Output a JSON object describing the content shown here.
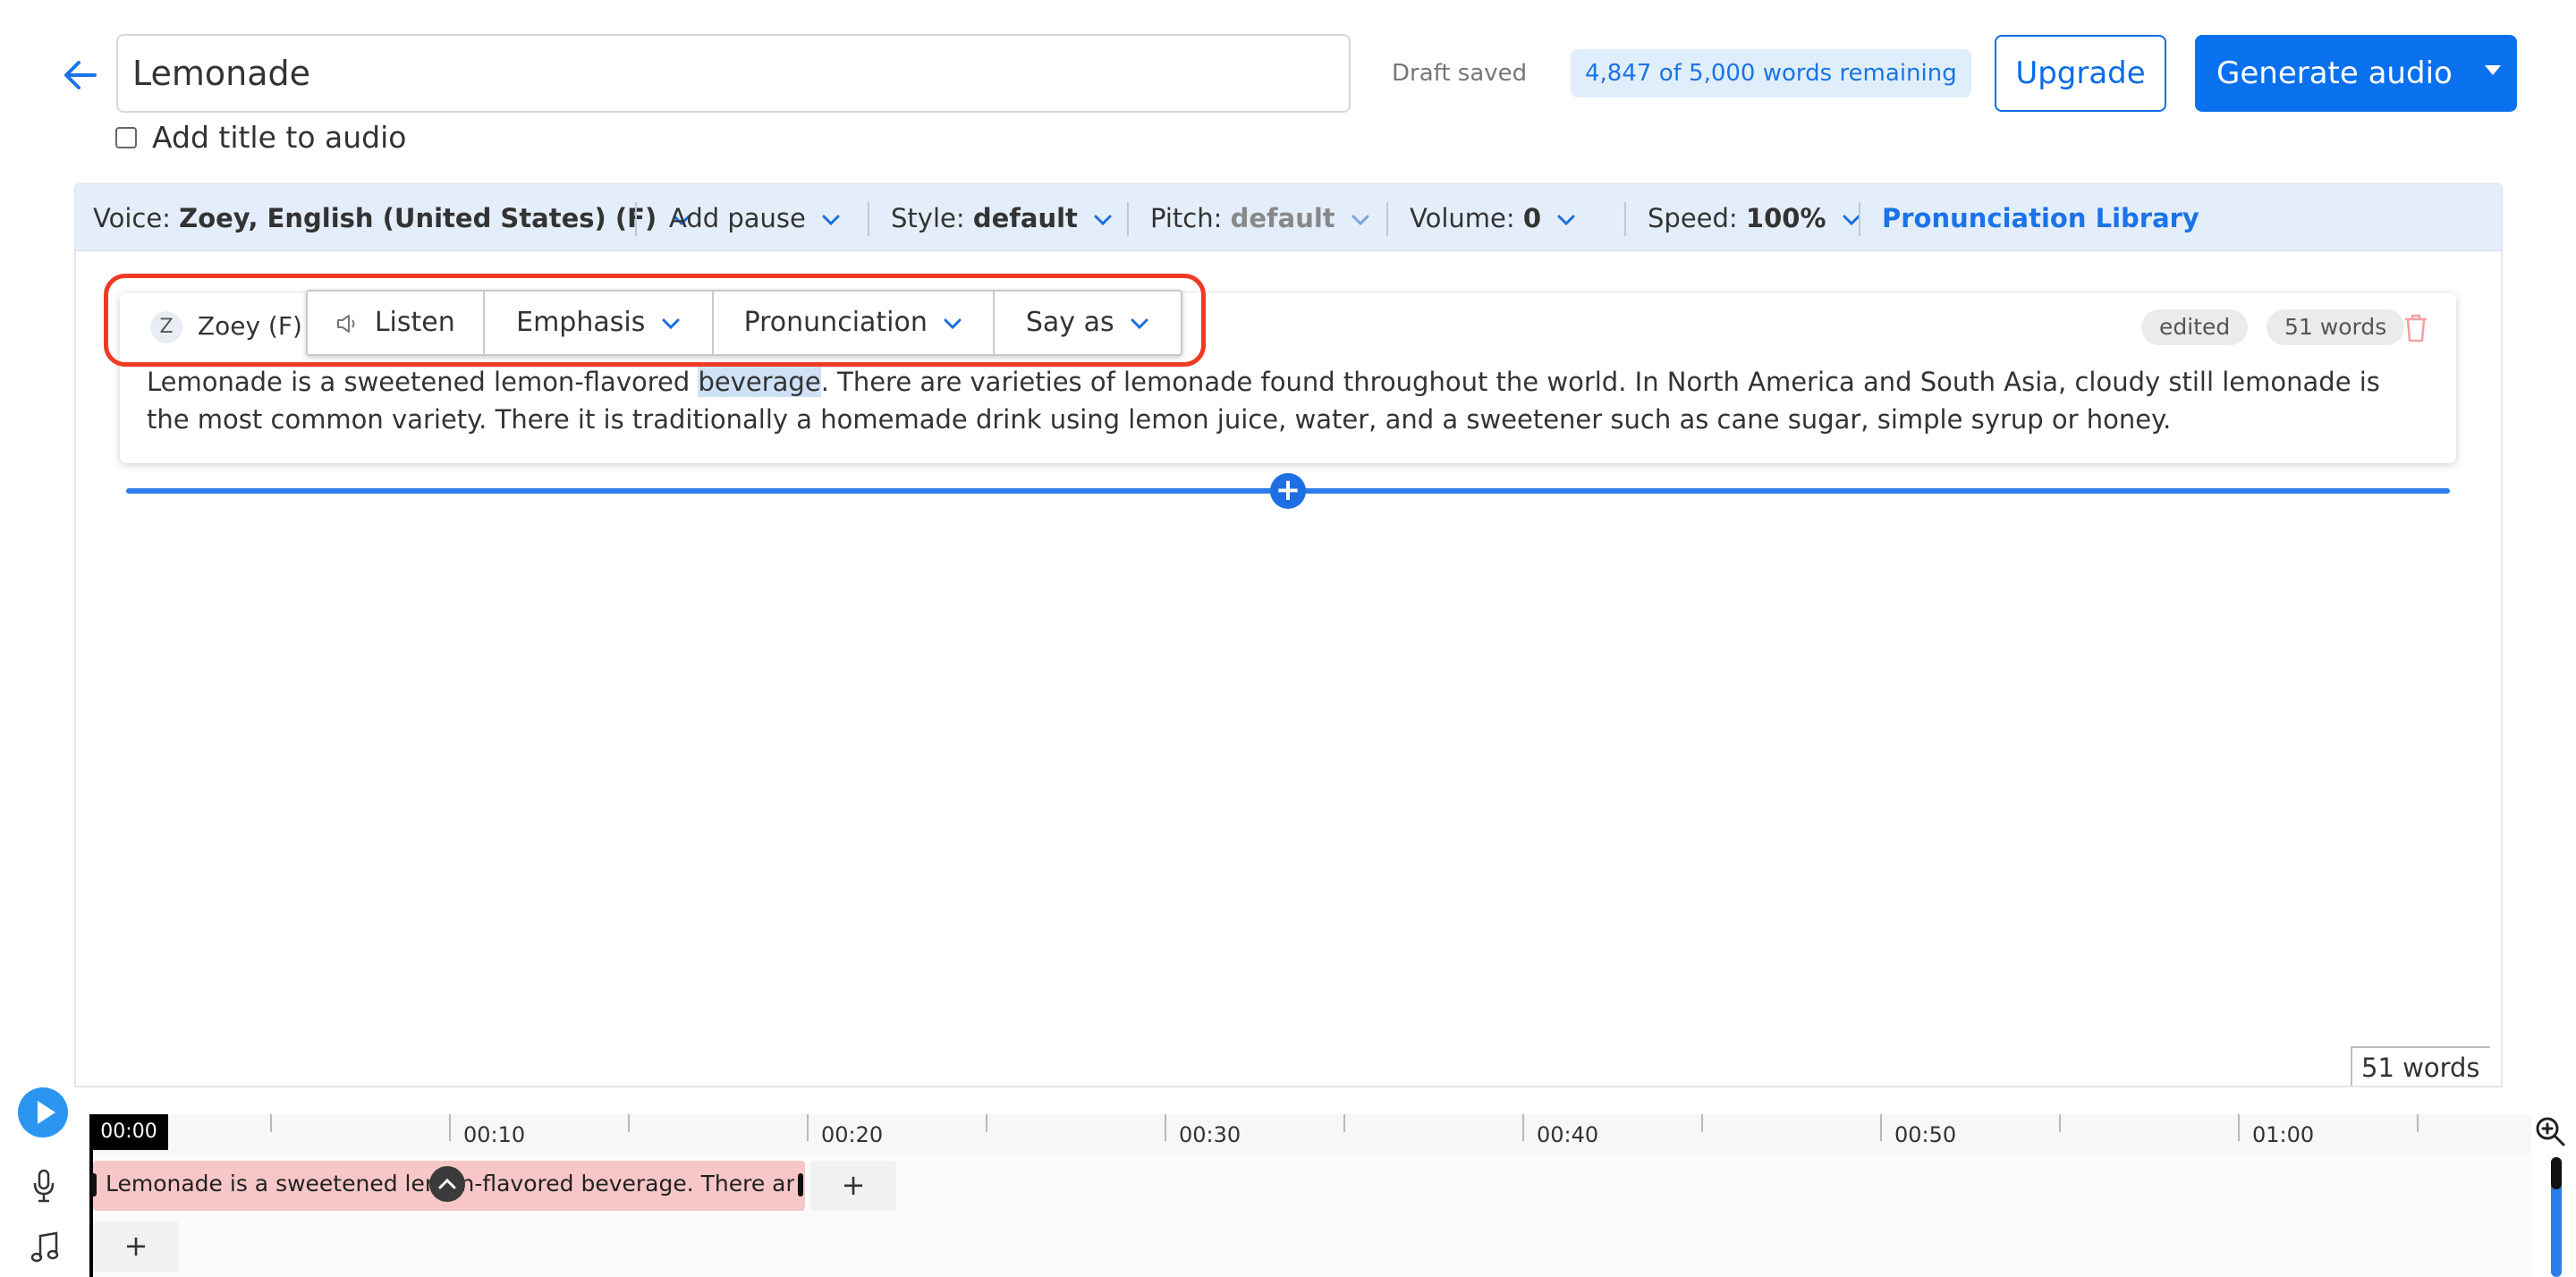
{
  "header": {
    "title_value": "Lemonade",
    "draft_status": "Draft saved",
    "words_remaining": "4,847 of 5,000 words remaining",
    "upgrade_label": "Upgrade",
    "generate_label": "Generate audio",
    "add_title_label": "Add title to audio"
  },
  "toolbar": {
    "voice_label": "Voice:",
    "voice_value": "Zoey, English (United States) (F)",
    "add_pause": "Add pause",
    "style_label": "Style:",
    "style_value": "default",
    "pitch_label": "Pitch:",
    "pitch_value": "default",
    "volume_label": "Volume:",
    "volume_value": "0",
    "speed_label": "Speed:",
    "speed_value": "100%",
    "pronunciation_library": "Pronunciation Library"
  },
  "block": {
    "voice_initial": "Z",
    "voice_name": "Zoey (F)",
    "popup": {
      "listen": "Listen",
      "emphasis": "Emphasis",
      "pronunciation": "Pronunciation",
      "say_as": "Say as"
    },
    "edited_badge": "edited",
    "word_count": "51 words",
    "text_before": "Lemonade is a sweetened lemon-flavored ",
    "text_selected": "beverage",
    "text_after": ". There are varieties of lemonade found throughout the world. In North America and South Asia, cloudy still lemonade is the most common variety. There it is traditionally a homemade drink using lemon juice, water, and a sweetener such as cane sugar, simple syrup or honey."
  },
  "editor_footer": {
    "word_count": "51 words"
  },
  "timeline": {
    "current_time": "00:00",
    "labels": [
      "00:10",
      "00:20",
      "00:30",
      "00:40",
      "00:50",
      "01:00"
    ],
    "clip_text": "Lemonade is a sweetened lemon-flavored beverage. There ar...",
    "add_symbol": "+"
  },
  "colors": {
    "accent": "#0a71ee",
    "highlight": "#ef3a24",
    "clip": "#f7c7c7"
  }
}
